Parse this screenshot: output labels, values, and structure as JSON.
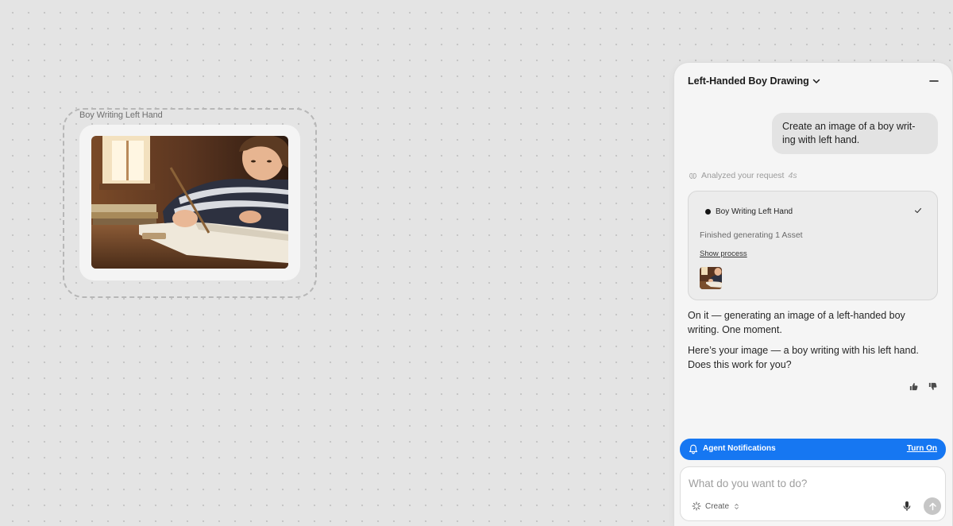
{
  "canvas": {
    "node_label": "Boy Writing Left Hand"
  },
  "panel": {
    "title": "Left-Handed Boy Drawing",
    "user_message": "Create an image of a boy writ-ing with left hand.",
    "analyzed": {
      "label": "Analyzed your request",
      "duration": "4s"
    },
    "process": {
      "title": "Boy Writing Left Hand",
      "status": "Finished generating 1 Asset",
      "show_process": "Show process"
    },
    "assistant_messages": [
      "On it — generating an image of a left-handed boy writing. One moment.",
      "Here’s your image — a boy writing with his left hand. Does this work for you?"
    ],
    "notification": {
      "label": "Agent Notifications",
      "action": "Turn On"
    },
    "composer": {
      "placeholder": "What do you want to do?",
      "mode": "Create"
    }
  },
  "colors": {
    "accent": "#1677f2",
    "canvas_bg": "#e4e4e4",
    "panel_bg": "#f5f5f5"
  },
  "icons": [
    "chevron-down-icon",
    "minimize-icon",
    "brain-icon",
    "check-icon",
    "thumbs-up-icon",
    "thumbs-down-icon",
    "bell-icon",
    "sparkle-icon",
    "updown-icon",
    "mic-icon",
    "arrow-up-icon"
  ]
}
